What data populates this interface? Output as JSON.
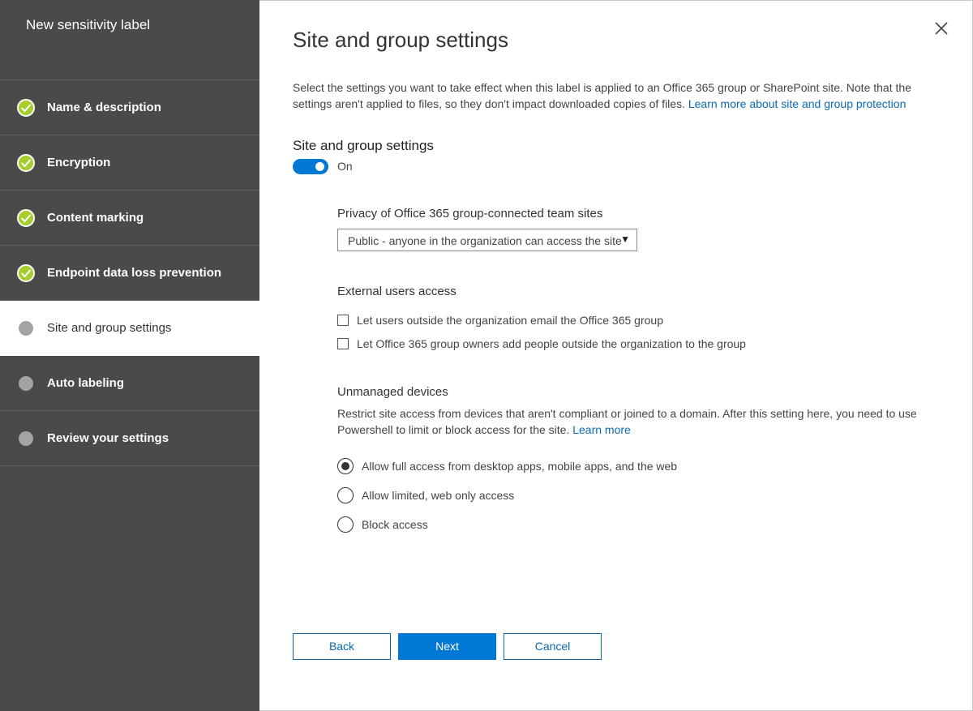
{
  "wizard": {
    "title": "New sensitivity label",
    "steps": [
      {
        "label": "Name & description",
        "status": "complete"
      },
      {
        "label": "Encryption",
        "status": "complete"
      },
      {
        "label": "Content marking",
        "status": "complete"
      },
      {
        "label": "Endpoint data loss prevention",
        "status": "complete"
      },
      {
        "label": "Site and group settings",
        "status": "current"
      },
      {
        "label": "Auto labeling",
        "status": "pending"
      },
      {
        "label": "Review your settings",
        "status": "pending"
      }
    ]
  },
  "page": {
    "title": "Site and group settings",
    "intro_text": "Select the settings you want to take effect when this label is applied to an Office 365 group or SharePoint site. Note that the settings aren't applied to files, so they don't impact downloaded copies of files.",
    "intro_link": "Learn more about site and group protection",
    "close_icon": "close-icon"
  },
  "site_group_settings": {
    "heading": "Site and group settings",
    "toggle_state": "On",
    "toggle_on": true
  },
  "privacy": {
    "label": "Privacy of Office 365 group-connected team sites",
    "selected": "Public - anyone in the organization can access the site",
    "caret": "▼"
  },
  "external_access": {
    "heading": "External users access",
    "options": [
      {
        "label": "Let users outside the organization email the Office 365 group",
        "checked": false
      },
      {
        "label": "Let Office 365 group owners add people outside the organization to the group",
        "checked": false
      }
    ]
  },
  "unmanaged_devices": {
    "heading": "Unmanaged devices",
    "description": "Restrict site access from devices that aren't compliant or joined to a domain. After this setting here, you need to use Powershell to limit or block access for the site.",
    "link": "Learn more",
    "options": [
      {
        "label": "Allow full access from desktop apps, mobile apps, and the web",
        "selected": true
      },
      {
        "label": "Allow limited, web only access",
        "selected": false
      },
      {
        "label": "Block access",
        "selected": false
      }
    ]
  },
  "footer": {
    "back_label": "Back",
    "next_label": "Next",
    "cancel_label": "Cancel"
  },
  "colors": {
    "sidebar_bg": "#4a4a4a",
    "complete_check": "#a4cf2b",
    "pending_dot": "#a3a3a3",
    "accent": "#0078d4",
    "link": "#0a6ab5"
  }
}
